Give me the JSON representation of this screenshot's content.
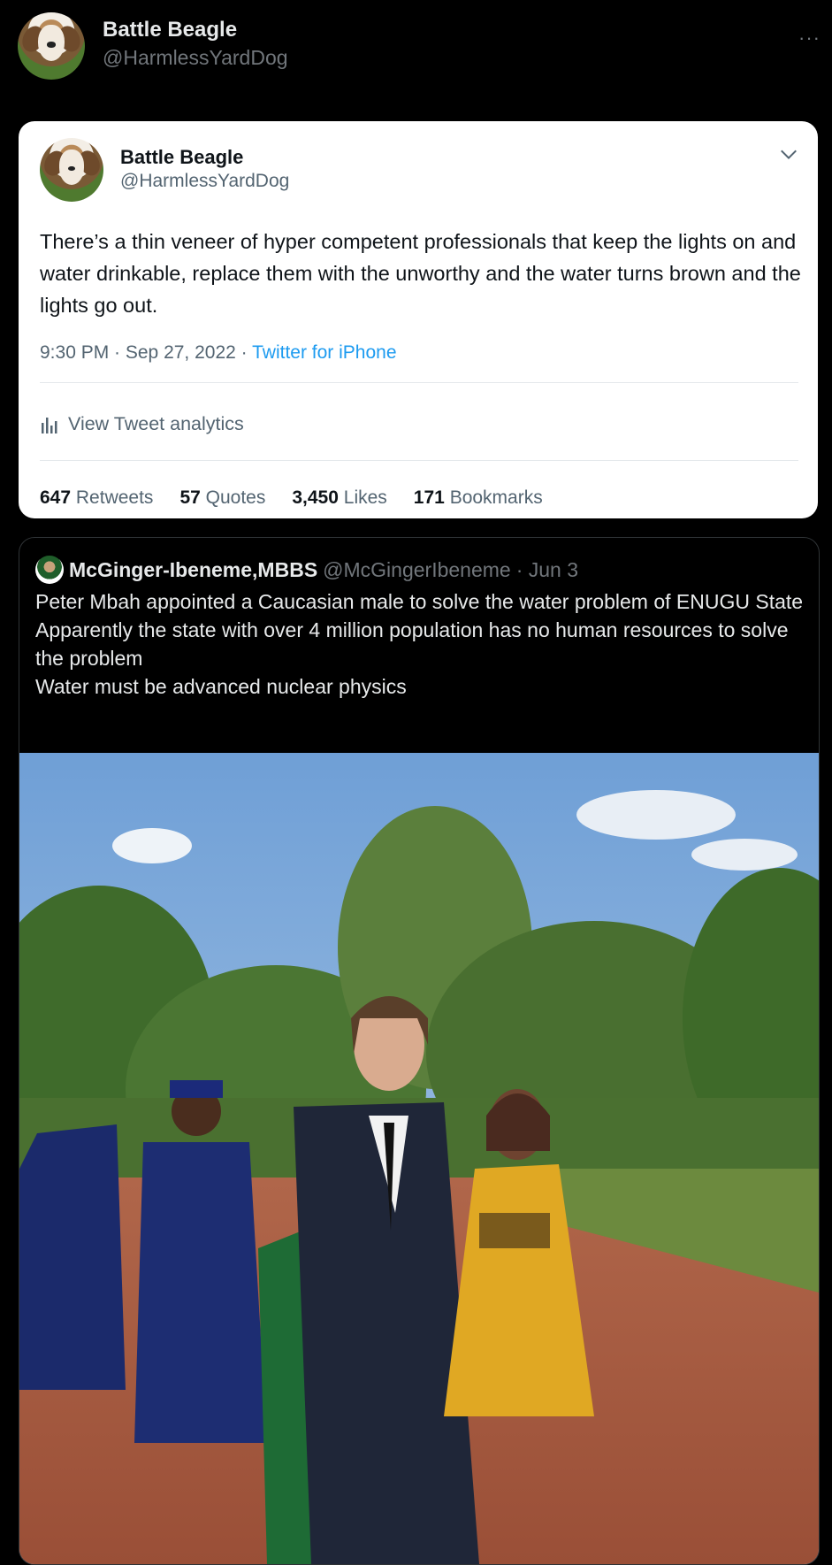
{
  "header": {
    "name": "Battle Beagle",
    "handle": "@HarmlessYardDog",
    "more_label": "···"
  },
  "tweet": {
    "name": "Battle Beagle",
    "handle": "@HarmlessYardDog",
    "text": "There’s a thin veneer of hyper competent professionals that keep the lights on and water drinkable, replace them with the unworthy and the water turns brown and the lights go out.",
    "time": "9:30 PM · Sep 27, 2022 · ",
    "source": "Twitter for iPhone",
    "analytics_label": "View Tweet analytics",
    "stats": [
      {
        "count": "647",
        "label": "Retweets"
      },
      {
        "count": "57",
        "label": "Quotes"
      },
      {
        "count": "3,450",
        "label": "Likes"
      },
      {
        "count": "171",
        "label": "Bookmarks"
      }
    ]
  },
  "quoted": {
    "name": "McGinger-Ibeneme,MBBS",
    "handle": "@McGingerIbeneme",
    "date": "· Jun 3",
    "lines": [
      "Peter Mbah appointed a Caucasian male to solve the water problem of ENUGU State",
      "Apparently the state with over 4 million population has no human resources to solve the problem",
      "Water must be advanced nuclear physics"
    ]
  },
  "colors": {
    "background": "#000000",
    "card": "#ffffff",
    "link": "#1d9bf0",
    "secondary": "#536471"
  }
}
